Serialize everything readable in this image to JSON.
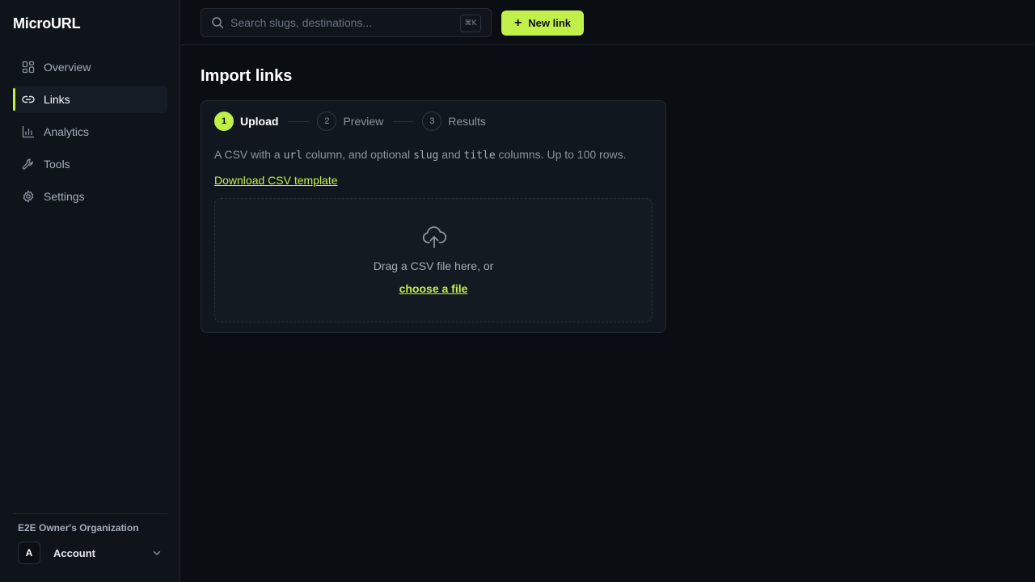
{
  "brand": "MicroURL",
  "nav": [
    {
      "label": "Overview",
      "icon": "grid-icon",
      "active": false
    },
    {
      "label": "Links",
      "icon": "link-icon",
      "active": true
    },
    {
      "label": "Analytics",
      "icon": "bar-chart-icon",
      "active": false
    },
    {
      "label": "Tools",
      "icon": "wrench-icon",
      "active": false
    },
    {
      "label": "Settings",
      "icon": "gear-icon",
      "active": false
    }
  ],
  "org": {
    "name": "E2E Owner's Organization",
    "account_initial": "A",
    "account_label": "Account"
  },
  "search": {
    "placeholder": "Search slugs, destinations...",
    "shortcut": "⌘K"
  },
  "new_link_label": "New link",
  "page_title": "Import links",
  "steps": [
    {
      "num": "1",
      "label": "Upload",
      "active": true
    },
    {
      "num": "2",
      "label": "Preview",
      "active": false
    },
    {
      "num": "3",
      "label": "Results",
      "active": false
    }
  ],
  "description": {
    "part1": "A CSV with a ",
    "code1": "url",
    "part2": " column, and optional ",
    "code2": "slug",
    "part3": " and ",
    "code3": "title",
    "part4": " columns. Up to 100 rows."
  },
  "template_link": "Download CSV template",
  "dropzone": {
    "text": "Drag a CSV file here, or",
    "choose_label": "choose a file"
  },
  "colors": {
    "accent": "#c2f04a",
    "background": "#0a0d12",
    "sidebar": "#0f141b"
  }
}
